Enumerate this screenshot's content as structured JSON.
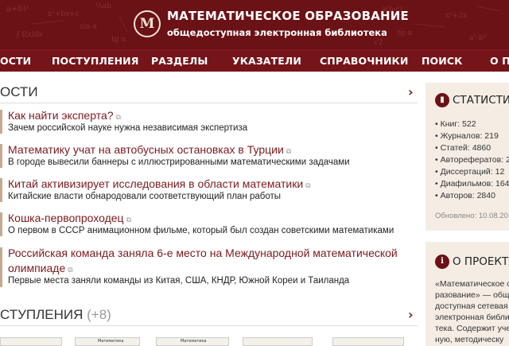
{
  "header": {
    "logo_glyph": "М",
    "title": "МАТЕМАТИЧЕСКОЕ ОБРАЗОВАНИЕ",
    "subtitle": "общедоступная электронная библиотека"
  },
  "nav": {
    "items": [
      "ОСТИ",
      "ПОСТУПЛЕНИЯ",
      "РАЗДЕЛЫ",
      "УКАЗАТЕЛИ",
      "СПРАВОЧНИКИ",
      "ПОИСК",
      "О П"
    ]
  },
  "news": {
    "section_title": "ОСТИ",
    "items": [
      {
        "title": "Как найти эксперта?",
        "desc": "Зачем российской науке нужна независимая экспертиза"
      },
      {
        "title": "Математику учат на автобусных остановках в Турции",
        "desc": "В городе вывесили баннеры с иллюстрированными математическими задачами"
      },
      {
        "title": "Китай активизирует исследования в области математики",
        "desc": "Китайские власти обнародовали соответствующий план работы"
      },
      {
        "title": "Кошка-первопроходец",
        "desc": "О первом в СССР анимационном фильме, который был создан советскими математиками"
      },
      {
        "title": "Российская команда заняла 6-е место на Международной математической",
        "title2": "олимпиаде",
        "desc": "Первые места заняли команды из Китая, США, КНДР, Южной Кореи и Таиланда"
      }
    ],
    "ext_icon": "external-link-icon"
  },
  "arrivals": {
    "section_title": "СТУПЛЕНИЯ",
    "count": "(+8)",
    "book_labels": [
      "Математика",
      "Математика"
    ]
  },
  "stats": {
    "title": "СТАТИСТИКА",
    "icon": "bar-chart-icon",
    "items": [
      "• Книг: 522",
      "• Журналов: 219",
      "• Статей: 4860",
      "• Авторефератов: 2",
      "• Диссертаций: 12",
      "• Диафильмов: 164",
      "• Авторов: 2840"
    ],
    "updated": "Обновлено: 10.08.201"
  },
  "about": {
    "title": "О ПРОЕКТЕ",
    "icon_glyph": "i",
    "lines": [
      "«Математическое о",
      "разование» — общ",
      "доступная сетевая",
      "электронная библи",
      "тека. Содержит уче",
      "ную, методическу"
    ]
  },
  "colors": {
    "brand": "#6b1216",
    "nav": "#751419",
    "link": "#7a1a1e",
    "sidebar_bg": "#f5ede4"
  }
}
